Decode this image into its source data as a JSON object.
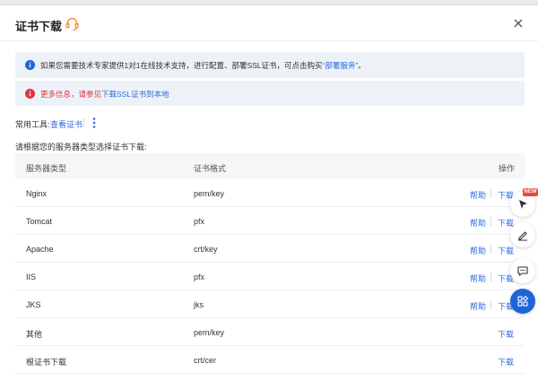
{
  "dialog": {
    "title": "证书下载",
    "notice1": {
      "text": "如果您需要技术专家提供1对1在线技术支持，进行配置、部署SSL证书，可点击购买",
      "link": "“部署服务”",
      "suffix": "。"
    },
    "notice2": {
      "text": "更多信息，请参见",
      "link": "下载SSL证书到本地"
    },
    "tools": {
      "label": "常用工具:",
      "link": "查看证书"
    },
    "select_hint": "请根据您的服务器类型选择证书下载:",
    "table": {
      "headers": [
        "服务器类型",
        "证书格式",
        "操作"
      ],
      "help_label": "帮助",
      "download_label": "下载",
      "rows": [
        {
          "server": "Nginx",
          "format": "pem/key",
          "help": true
        },
        {
          "server": "Tomcat",
          "format": "pfx",
          "help": true
        },
        {
          "server": "Apache",
          "format": "crt/key",
          "help": true
        },
        {
          "server": "IIS",
          "format": "pfx",
          "help": true
        },
        {
          "server": "JKS",
          "format": "jks",
          "help": true
        },
        {
          "server": "其他",
          "format": "pem/key",
          "help": false
        },
        {
          "server": "根证书下载",
          "format": "crt/cer",
          "help": false
        }
      ]
    }
  },
  "float_toolbar": {
    "new_badge": "NEW",
    "buttons": [
      "cursor-icon",
      "edit-icon",
      "message-icon",
      "apps-icon"
    ]
  },
  "colors": {
    "link": "#2a6bdb",
    "error": "#e0333d",
    "notice_bg": "#edf2f9",
    "accent": "#1f63d9",
    "headset": "#f08a24"
  }
}
